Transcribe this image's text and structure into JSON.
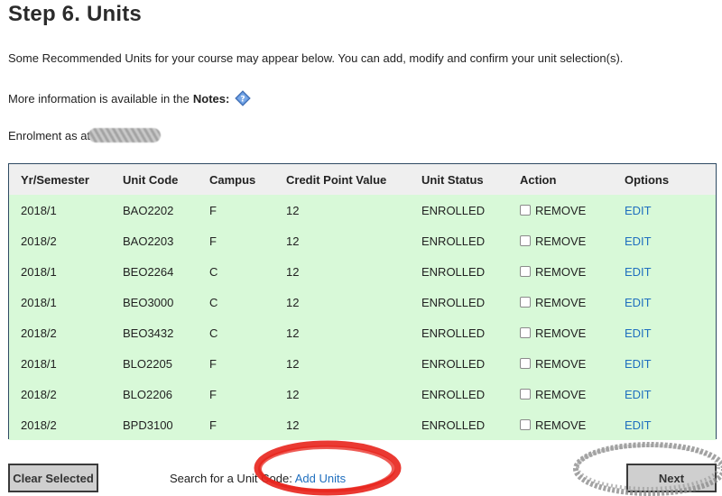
{
  "header": {
    "title": "Step 6. Units"
  },
  "intro": {
    "text": "Some Recommended Units for your course may appear below. You can add, modify and confirm your unit selection(s)."
  },
  "notes": {
    "prefix": "More information is available in the",
    "label": "Notes:"
  },
  "enrolment": {
    "label": "Enrolment as at"
  },
  "table": {
    "headers": [
      "Yr/Semester",
      "Unit Code",
      "Campus",
      "Credit Point Value",
      "Unit Status",
      "Action",
      "Options"
    ],
    "rows": [
      {
        "semester": "2018/1",
        "code": "BAO2202",
        "campus": "F",
        "credit": "12",
        "status": "ENROLLED",
        "action": "REMOVE",
        "option": "EDIT"
      },
      {
        "semester": "2018/2",
        "code": "BAO2203",
        "campus": "F",
        "credit": "12",
        "status": "ENROLLED",
        "action": "REMOVE",
        "option": "EDIT"
      },
      {
        "semester": "2018/1",
        "code": "BEO2264",
        "campus": "C",
        "credit": "12",
        "status": "ENROLLED",
        "action": "REMOVE",
        "option": "EDIT"
      },
      {
        "semester": "2018/1",
        "code": "BEO3000",
        "campus": "C",
        "credit": "12",
        "status": "ENROLLED",
        "action": "REMOVE",
        "option": "EDIT"
      },
      {
        "semester": "2018/2",
        "code": "BEO3432",
        "campus": "C",
        "credit": "12",
        "status": "ENROLLED",
        "action": "REMOVE",
        "option": "EDIT"
      },
      {
        "semester": "2018/1",
        "code": "BLO2205",
        "campus": "F",
        "credit": "12",
        "status": "ENROLLED",
        "action": "REMOVE",
        "option": "EDIT"
      },
      {
        "semester": "2018/2",
        "code": "BLO2206",
        "campus": "F",
        "credit": "12",
        "status": "ENROLLED",
        "action": "REMOVE",
        "option": "EDIT"
      },
      {
        "semester": "2018/2",
        "code": "BPD3100",
        "campus": "F",
        "credit": "12",
        "status": "ENROLLED",
        "action": "REMOVE",
        "option": "EDIT"
      }
    ]
  },
  "footer": {
    "clear_label": "Clear Selected",
    "search_prefix": "Search for a Unit Code:",
    "add_units_label": "Add Units",
    "next_label": "Next"
  },
  "colors": {
    "row_background": "#d8f9d8",
    "header_background": "#efefef",
    "link": "#1f6fbf",
    "annotation_red": "#e8241c",
    "annotation_gray": "#8c8c8c"
  },
  "icons": {
    "notes_help": "help-diamond-icon"
  }
}
